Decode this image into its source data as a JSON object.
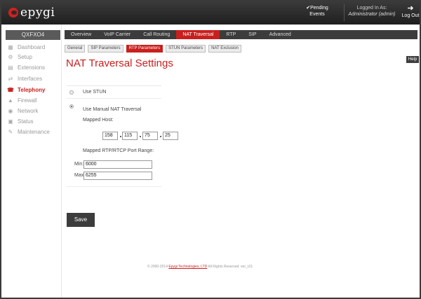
{
  "header": {
    "logo_text": "epygi",
    "pending": {
      "label": "Pending",
      "sub": "Events"
    },
    "login": {
      "label": "Logged In As:",
      "user": "Administrator (admin)"
    },
    "logout_label": "Log Out"
  },
  "sidebar": {
    "title": "QXFXO4",
    "items": [
      {
        "label": "Dashboard",
        "icon": "dashboard-icon"
      },
      {
        "label": "Setup",
        "icon": "gear-icon"
      },
      {
        "label": "Extensions",
        "icon": "extensions-icon"
      },
      {
        "label": "Interfaces",
        "icon": "interfaces-icon"
      },
      {
        "label": "Telephony",
        "icon": "phone-icon",
        "active": true
      },
      {
        "label": "Firewall",
        "icon": "firewall-icon"
      },
      {
        "label": "Network",
        "icon": "network-icon"
      },
      {
        "label": "Status",
        "icon": "status-icon"
      },
      {
        "label": "Maintenance",
        "icon": "wrench-icon"
      }
    ]
  },
  "topnav": [
    "Overview",
    "VoIP Carrier",
    "Call Routing",
    "NAT Traversal",
    "RTP",
    "SIP",
    "Advanced"
  ],
  "topnav_active": "NAT Traversal",
  "subnav": [
    "General",
    "SIP Parameters",
    "RTP Parameters",
    "STUN Parameters",
    "NAT Exclusion"
  ],
  "subnav_active": "RTP Parameters",
  "help_label": "Help",
  "page_title": "NAT Traversal Settings",
  "form": {
    "use_stun": "Use STUN",
    "use_manual": "Use Manual NAT Traversal",
    "mapped_host": "Mapped Host:",
    "ip": [
      "158",
      "115",
      "75",
      "25"
    ],
    "port_range": "Mapped RTP/RTCP Port Range:",
    "min_label": "Min:",
    "min_value": "6000",
    "max_label": "Max:",
    "max_value": "6255",
    "selected": "manual"
  },
  "save_label": "Save",
  "footer": {
    "pre": "© 2000-2014",
    "link": "Epygi Technologies, LTD",
    "post": "All Rights Reserved. ver_US"
  },
  "colors": {
    "accent": "#c8201e",
    "dark": "#3c3c3c"
  }
}
